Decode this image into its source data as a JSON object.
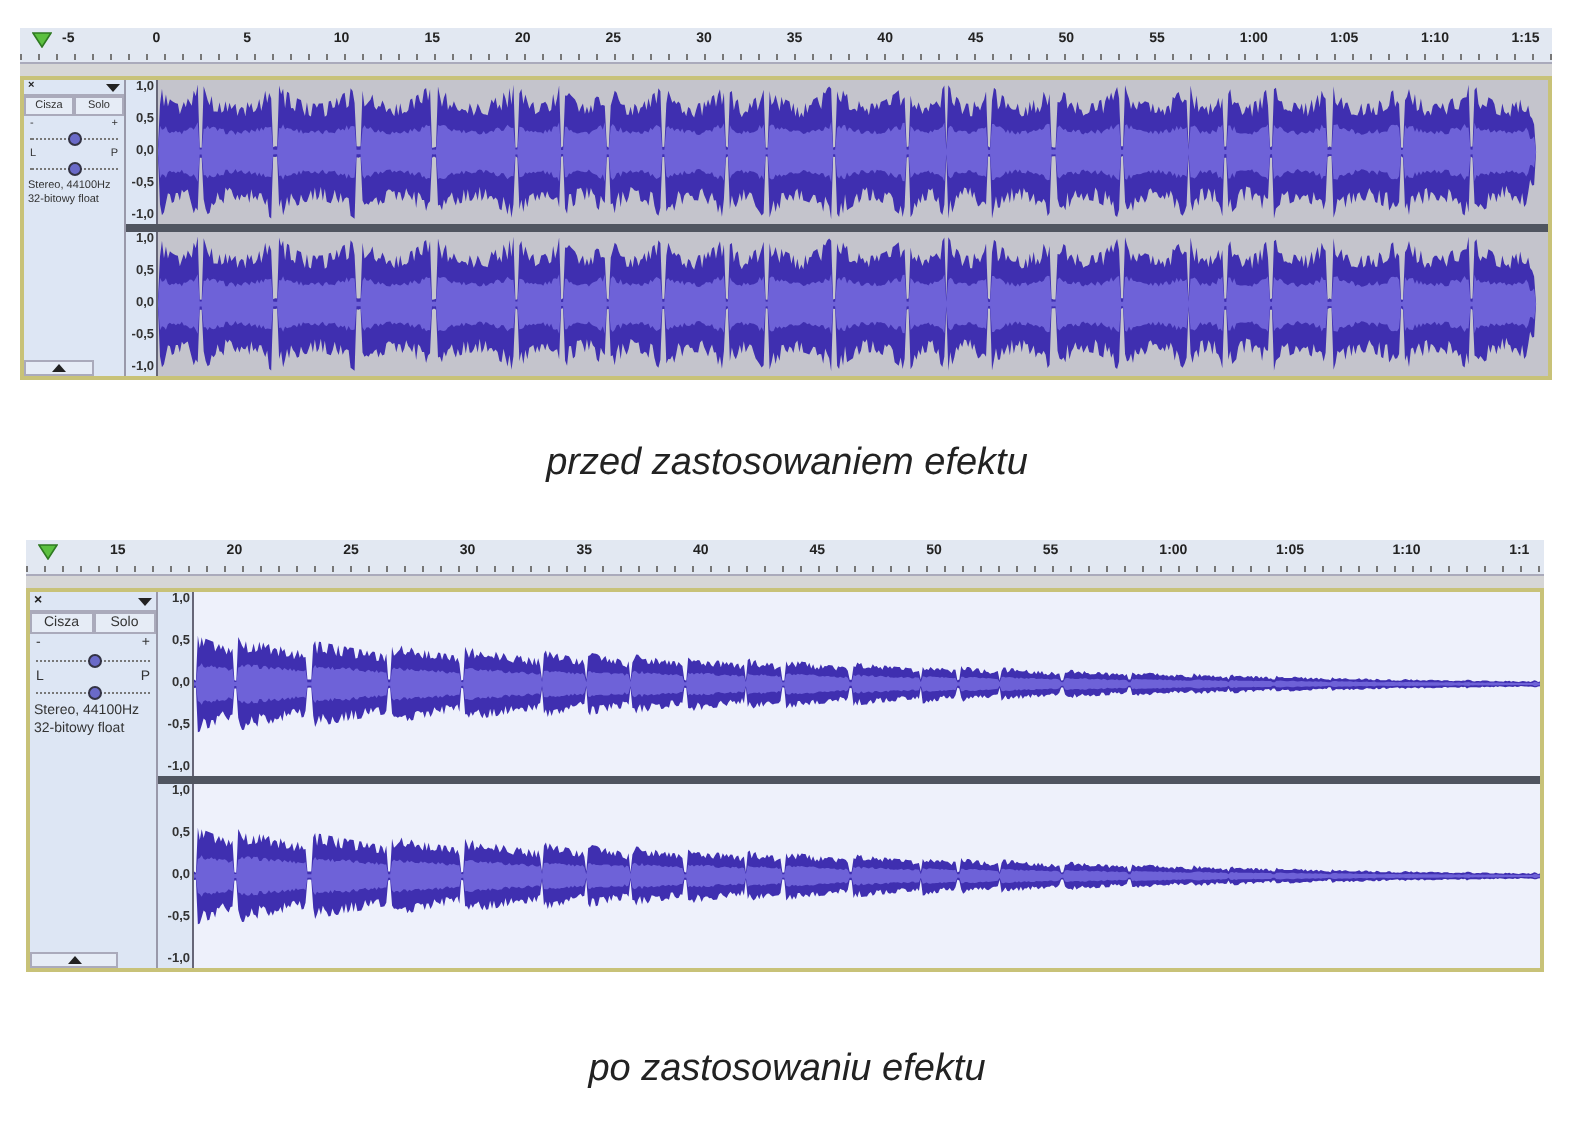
{
  "figures": [
    {
      "ruler": {
        "labels": [
          "-5",
          "0",
          "5",
          "10",
          "15",
          "20",
          "25",
          "30",
          "35",
          "40",
          "45",
          "50",
          "55",
          "1:00",
          "1:05",
          "1:10",
          "1:15"
        ]
      },
      "track": {
        "close": "×",
        "buttons": [
          "Cisza",
          "Solo"
        ],
        "gain": {
          "min_label": "-",
          "max_label": "+",
          "level": 0.5
        },
        "pan": {
          "min_label": "L",
          "max_label": "P",
          "level": 0.5
        },
        "info": [
          "Stereo, 44100Hz",
          "32-bitowy float"
        ],
        "selected": true,
        "kind": "pulses",
        "channels": [
          {
            "scale": [
              "1,0",
              "0,5",
              "0,0",
              "-0,5",
              "-1,0"
            ]
          },
          {
            "scale": [
              "1,0",
              "0,5",
              "0,0",
              "-0,5",
              "-1,0"
            ]
          }
        ]
      },
      "caption": "przed zastosowaniem efektu"
    },
    {
      "ruler": {
        "labels": [
          "15",
          "20",
          "25",
          "30",
          "35",
          "40",
          "45",
          "50",
          "55",
          "1:00",
          "1:05",
          "1:10",
          "1:1"
        ]
      },
      "track": {
        "close": "×",
        "buttons": [
          "Cisza",
          "Solo"
        ],
        "gain": {
          "min_label": "-",
          "max_label": "+",
          "level": 0.5
        },
        "pan": {
          "min_label": "L",
          "max_label": "P",
          "level": 0.5
        },
        "info": [
          "Stereo, 44100Hz",
          "32-bitowy float"
        ],
        "selected": false,
        "kind": "fade",
        "channels": [
          {
            "scale": [
              "1,0",
              "0,5",
              "0,0",
              "-0,5",
              "-1,0"
            ]
          },
          {
            "scale": [
              "1,0",
              "0,5",
              "0,0",
              "-0,5",
              "-1,0"
            ]
          }
        ]
      },
      "caption": "po zastosowaniu efektu"
    }
  ]
}
